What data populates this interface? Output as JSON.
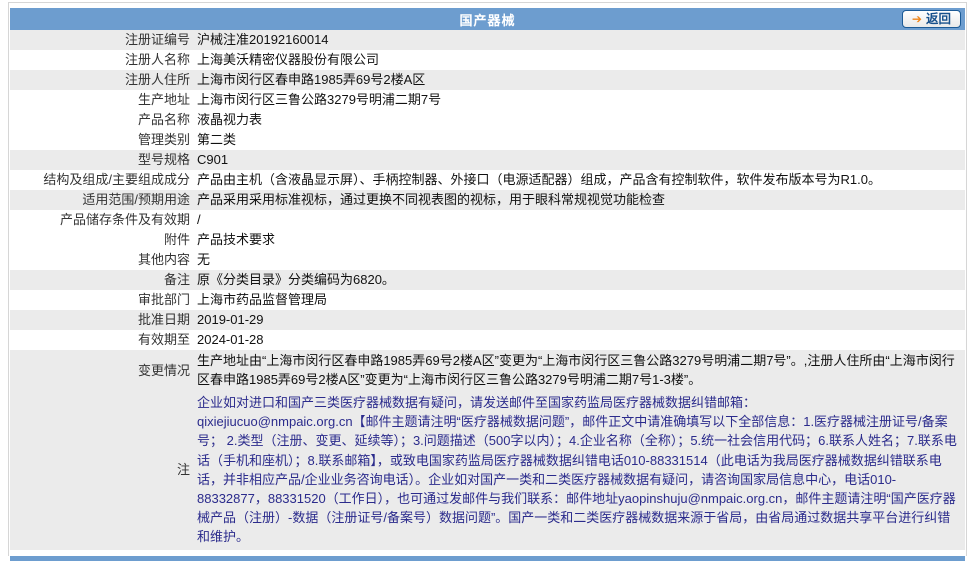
{
  "header": {
    "title": "国产器械",
    "back_label": "返回",
    "back_arrow_icon": "arrow-right-icon"
  },
  "colors": {
    "header_bg": "#6D9DCF",
    "stripe_bg": "#EBEBEB",
    "note_text": "#2B2B8C",
    "border": "#D6D6D6",
    "back_text": "#17508C",
    "arrow": "#F08519"
  },
  "table": {
    "rows": [
      {
        "label": "注册证编号",
        "value": "沪械注准20192160014",
        "shaded": true
      },
      {
        "label": "注册人名称",
        "value": "上海美沃精密仪器股份有限公司",
        "shaded": false
      },
      {
        "label": "注册人住所",
        "value": "上海市闵行区春申路1985弄69号2楼A区",
        "shaded": true
      },
      {
        "label": "生产地址",
        "value": "上海市闵行区三鲁公路3279号明浦二期7号",
        "shaded": false
      },
      {
        "label": "产品名称",
        "value": "液晶视力表",
        "shaded": false
      },
      {
        "label": "管理类别",
        "value": "第二类",
        "shaded": false
      },
      {
        "label": "型号规格",
        "value": "C901",
        "shaded": true
      },
      {
        "label": "结构及组成/主要组成成分",
        "value": "产品由主机（含液晶显示屏）、手柄控制器、外接口（电源适配器）组成，产品含有控制软件，软件发布版本号为R1.0。",
        "shaded": false
      },
      {
        "label": "适用范围/预期用途",
        "value": "产品采用采用标准视标，通过更换不同视表图的视标，用于眼科常规视觉功能检查",
        "shaded": true
      },
      {
        "label": "产品储存条件及有效期",
        "value": "/",
        "shaded": false
      },
      {
        "label": "附件",
        "value": "产品技术要求",
        "shaded": false
      },
      {
        "label": "其他内容",
        "value": "无",
        "shaded": false
      },
      {
        "label": "备注",
        "value": "原《分类目录》分类编码为6820。",
        "shaded": true
      },
      {
        "label": "审批部门",
        "value": "上海市药品监督管理局",
        "shaded": false
      },
      {
        "label": "批准日期",
        "value": "2019-01-29",
        "shaded": true
      },
      {
        "label": "有效期至",
        "value": "2024-01-28",
        "shaded": false
      },
      {
        "label": "变更情况",
        "value": "生产地址由“上海市闵行区春申路1985弄69号2楼A区”变更为“上海市闵行区三鲁公路3279号明浦二期7号”。,注册人住所由“上海市闵行区春申路1985弄69号2楼A区”变更为“上海市闵行区三鲁公路3279号明浦二期7号1-3楼”。",
        "shaded": true,
        "multiline": true
      },
      {
        "label": "注",
        "value": "企业如对进口和国产三类医疗器械数据有疑问，请发送邮件至国家药监局医疗器械数据纠错邮箱：\nqixiejiucuo@nmpaic.org.cn【邮件主题请注明“医疗器械数据问题”，邮件正文中请准确填写以下全部信息：1.医疗器械注册证号/备案号； 2.类型（注册、变更、延续等）；3.问题描述（500字以内）；4.企业名称（全称）；5.统一社会信用代码；6.联系人姓名；7.联系电话（手机和座机）；8.联系邮箱】，或致电国家药监局医疗器械数据纠错电话010-88331514（此电话为我局医疗器械数据纠错联系电话，并非相应产品/企业业务咨询电话）。企业如对国产一类和二类医疗器械数据有疑问，请咨询国家局信息中心，电话010-88332877，88331520（工作日），也可通过发邮件与我们联系：邮件地址yaopinshuju@nmpaic.org.cn，邮件主题请注明“国产医疗器械产品（注册）-数据（注册证号/备案号）数据问题”。国产一类和二类医疗器械数据来源于省局，由省局通过数据共享平台进行纠错和维护。",
        "shaded": true,
        "note": true
      }
    ]
  }
}
